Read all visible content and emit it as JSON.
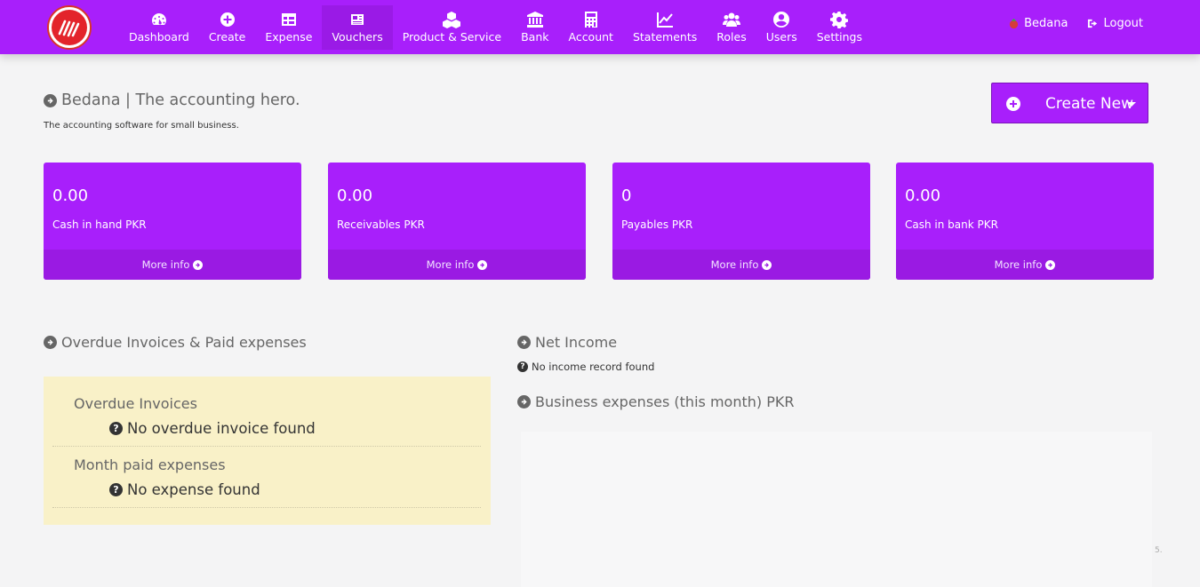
{
  "nav": {
    "items": [
      {
        "label": "Dashboard",
        "icon": "dashboard-icon"
      },
      {
        "label": "Create",
        "icon": "plus-circle-icon"
      },
      {
        "label": "Expense",
        "icon": "table-icon"
      },
      {
        "label": "Vouchers",
        "icon": "newspaper-icon",
        "active": true
      },
      {
        "label": "Product & Service",
        "icon": "cubes-icon"
      },
      {
        "label": "Bank",
        "icon": "bank-icon"
      },
      {
        "label": "Account",
        "icon": "calculator-icon"
      },
      {
        "label": "Statements",
        "icon": "line-chart-icon"
      },
      {
        "label": "Roles",
        "icon": "users-icon"
      },
      {
        "label": "Users",
        "icon": "user-circle-icon"
      },
      {
        "label": "Settings",
        "icon": "gear-icon"
      }
    ],
    "user": "Bedana",
    "logout": "Logout"
  },
  "header": {
    "title": "Bedana | The accounting hero.",
    "subtitle": "The accounting software for small business.",
    "create_button": "Create New"
  },
  "stats": [
    {
      "value": "0.00",
      "caption": "Cash in hand PKR",
      "more": "More info"
    },
    {
      "value": "0.00",
      "caption": "Receivables PKR",
      "more": "More info"
    },
    {
      "value": "0",
      "caption": "Payables PKR",
      "more": "More info"
    },
    {
      "value": "0.00",
      "caption": "Cash in bank PKR",
      "more": "More info"
    }
  ],
  "overdue": {
    "title": "Overdue Invoices & Paid expenses",
    "invoices_heading": "Overdue Invoices",
    "invoices_message": "No overdue invoice found",
    "expenses_heading": "Month paid expenses",
    "expenses_message": "No expense found"
  },
  "net_income": {
    "title": "Net Income",
    "message": "No income record found"
  },
  "business_expenses": {
    "title": "Business expenses (this month) PKR",
    "tick": "5."
  },
  "colors": {
    "primary": "#a81ffb",
    "primary_dark": "#9a1ae3",
    "warning_bg": "#f9f1c8"
  }
}
